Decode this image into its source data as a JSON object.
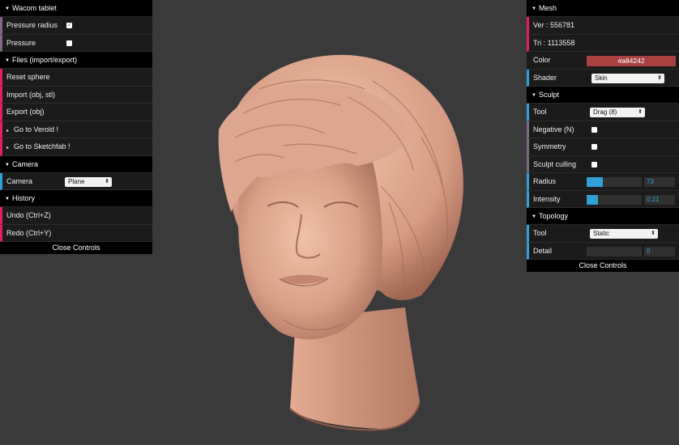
{
  "left": {
    "wacom": {
      "title": "Wacom tablet",
      "pressure_radius": {
        "label": "Pressure radius",
        "checked": true
      },
      "pressure": {
        "label": "Pressure",
        "checked": false
      }
    },
    "files": {
      "title": "Files (import/export)",
      "reset": "Reset sphere",
      "import": "Import (obj, stl)",
      "export": "Export (obj)"
    },
    "verold": "Go to Verold !",
    "sketchfab": "Go to Sketchfab !",
    "camera": {
      "title": "Camera",
      "label": "Camera",
      "value": "Plane"
    },
    "history": {
      "title": "History",
      "undo": "Undo (Ctrl+Z)",
      "redo": "Redo (Ctrl+Y)"
    },
    "close": "Close Controls"
  },
  "right": {
    "mesh": {
      "title": "Mesh",
      "ver": "Ver : 556781",
      "tri": "Tri : 1113558",
      "color_label": "Color",
      "color_value": "#a84242",
      "shader_label": "Shader",
      "shader_value": "Skin"
    },
    "sculpt": {
      "title": "Sculpt",
      "tool_label": "Tool",
      "tool_value": "Drag (8)",
      "negative": {
        "label": "Negative (N)",
        "checked": false
      },
      "symmetry": {
        "label": "Symmetry",
        "checked": false
      },
      "culling": {
        "label": "Sculpt culling",
        "checked": false
      },
      "radius_label": "Radius",
      "radius_value": "73",
      "radius_fraction": 0.29,
      "intensity_label": "Intensity",
      "intensity_value": "0.21",
      "intensity_fraction": 0.21
    },
    "topology": {
      "title": "Topology",
      "tool_label": "Tool",
      "tool_value": "Static",
      "detail_label": "Detail",
      "detail_value": "0",
      "detail_fraction": 0
    },
    "close": "Close Controls"
  },
  "colors": {
    "background": "#3a3a3a",
    "skin": "#d9a088",
    "accent": "#2fa1d6"
  }
}
